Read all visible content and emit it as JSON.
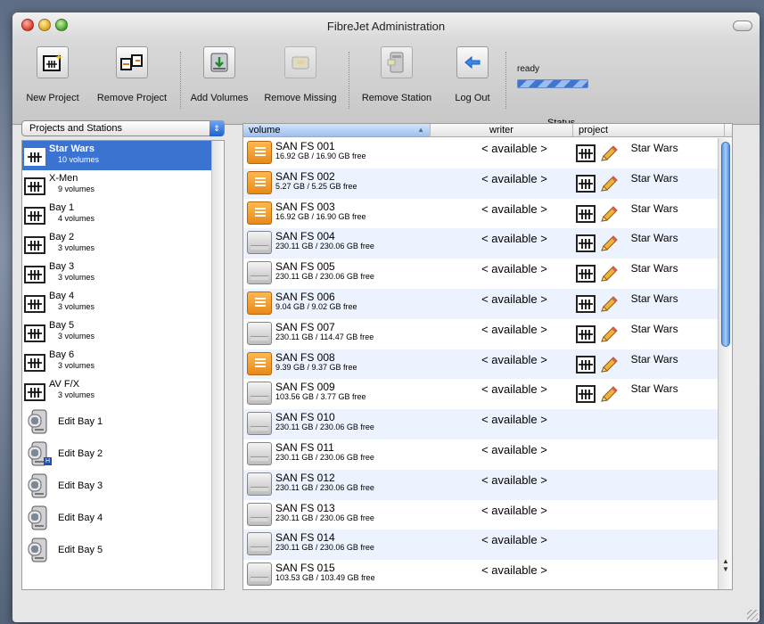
{
  "window": {
    "title": "FibreJet Administration"
  },
  "toolbar": {
    "items": [
      {
        "label": "New Project",
        "icon": "new-project-icon"
      },
      {
        "label": "Remove Project",
        "icon": "remove-project-icon"
      },
      {
        "label": "Add Volumes",
        "icon": "add-volumes-icon"
      },
      {
        "label": "Remove Missing",
        "icon": "remove-missing-icon"
      },
      {
        "label": "Remove Station",
        "icon": "remove-station-icon"
      },
      {
        "label": "Log Out",
        "icon": "log-out-icon"
      }
    ],
    "status_text": "ready",
    "status_label": "Status"
  },
  "sidebar": {
    "popup_value": "Projects and Stations",
    "projects": [
      {
        "name": "Star Wars",
        "sub": "10 volumes",
        "selected": true
      },
      {
        "name": "X-Men",
        "sub": "9 volumes"
      },
      {
        "name": "Bay 1",
        "sub": "4 volumes"
      },
      {
        "name": "Bay 2",
        "sub": "3 volumes"
      },
      {
        "name": "Bay 3",
        "sub": "3 volumes"
      },
      {
        "name": "Bay 4",
        "sub": "3 volumes"
      },
      {
        "name": "Bay 5",
        "sub": "3 volumes"
      },
      {
        "name": "Bay 6",
        "sub": "3 volumes"
      },
      {
        "name": "AV F/X",
        "sub": "3 volumes"
      }
    ],
    "stations": [
      {
        "name": "Edit Bay 1"
      },
      {
        "name": "Edit Bay 2",
        "badge": "H"
      },
      {
        "name": "Edit Bay 3"
      },
      {
        "name": "Edit Bay 4"
      },
      {
        "name": "Edit Bay 5"
      }
    ]
  },
  "table": {
    "columns": [
      "volume",
      "writer",
      "project"
    ],
    "rows": [
      {
        "name": "SAN FS 001",
        "info": "16.92 GB / 16.90 GB free",
        "color": "orange",
        "writer": "< available >",
        "project": "Star Wars"
      },
      {
        "name": "SAN FS 002",
        "info": "5.27 GB / 5.25 GB free",
        "color": "orange",
        "writer": "< available >",
        "project": "Star Wars"
      },
      {
        "name": "SAN FS 003",
        "info": "16.92 GB / 16.90 GB free",
        "color": "orange",
        "writer": "< available >",
        "project": "Star Wars"
      },
      {
        "name": "SAN FS 004",
        "info": "230.11 GB / 230.06 GB free",
        "color": "grey",
        "writer": "< available >",
        "project": "Star Wars"
      },
      {
        "name": "SAN FS 005",
        "info": "230.11 GB / 230.06 GB free",
        "color": "grey",
        "writer": "< available >",
        "project": "Star Wars"
      },
      {
        "name": "SAN FS 006",
        "info": "9.04 GB / 9.02 GB free",
        "color": "orange",
        "writer": "< available >",
        "project": "Star Wars"
      },
      {
        "name": "SAN FS 007",
        "info": "230.11 GB / 114.47 GB free",
        "color": "grey",
        "writer": "< available >",
        "project": "Star Wars"
      },
      {
        "name": "SAN FS 008",
        "info": "9.39 GB / 9.37 GB free",
        "color": "orange",
        "writer": "< available >",
        "project": "Star Wars"
      },
      {
        "name": "SAN FS 009",
        "info": "103.56 GB / 3.77 GB free",
        "color": "grey",
        "writer": "< available >",
        "project": "Star Wars"
      },
      {
        "name": "SAN FS 010",
        "info": "230.11 GB / 230.06 GB free",
        "color": "grey",
        "writer": "< available >",
        "project": ""
      },
      {
        "name": "SAN FS 011",
        "info": "230.11 GB / 230.06 GB free",
        "color": "grey",
        "writer": "< available >",
        "project": ""
      },
      {
        "name": "SAN FS 012",
        "info": "230.11 GB / 230.06 GB free",
        "color": "grey",
        "writer": "< available >",
        "project": ""
      },
      {
        "name": "SAN FS 013",
        "info": "230.11 GB / 230.06 GB free",
        "color": "grey",
        "writer": "< available >",
        "project": ""
      },
      {
        "name": "SAN FS 014",
        "info": "230.11 GB / 230.06 GB free",
        "color": "grey",
        "writer": "< available >",
        "project": ""
      },
      {
        "name": "SAN FS 015",
        "info": "103.53 GB / 103.49 GB free",
        "color": "grey",
        "writer": "< available >",
        "project": ""
      }
    ]
  },
  "colors": {
    "selection": "#3a73d1",
    "alt_row": "#edf3fe",
    "accent_orange": "#f0a030"
  }
}
